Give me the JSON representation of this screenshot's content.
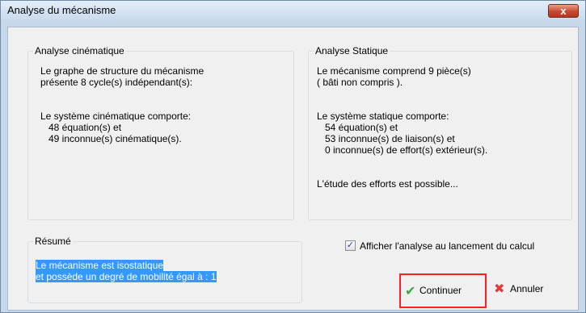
{
  "window": {
    "title": "Analyse du mécanisme",
    "close_label": "x"
  },
  "kinematic": {
    "label": "Analyse cinématique",
    "line1": "Le graphe de structure du mécanisme",
    "line2": "présente 8 cycle(s) indépendant(s):",
    "line3": "Le système cinématique comporte:",
    "line4": "48 équation(s) et",
    "line5": "49 inconnue(s) cinématique(s)."
  },
  "static": {
    "label": "Analyse Statique",
    "line1": "Le mécanisme comprend 9 pièce(s)",
    "line2": "( bâti non compris ).",
    "line3": "Le système statique comporte:",
    "line4": "54 équation(s) et",
    "line5": "53 inconnue(s) de liaison(s) et",
    "line6": "0 inconnue(s) de effort(s) extérieur(s).",
    "line7": "L'étude des efforts est possible..."
  },
  "summary": {
    "label": "Résumé",
    "line1": "Le mécanisme est isostatique",
    "line2": "et possède un degré de mobilité égal à : 1"
  },
  "options": {
    "show_analysis_label": "Afficher l'analyse au lancement du calcul",
    "show_analysis_checked": true
  },
  "buttons": {
    "continue_label": "Continuer",
    "cancel_label": "Annuler"
  },
  "icons": {
    "continue": "checkmark-icon",
    "cancel": "cross-icon"
  }
}
